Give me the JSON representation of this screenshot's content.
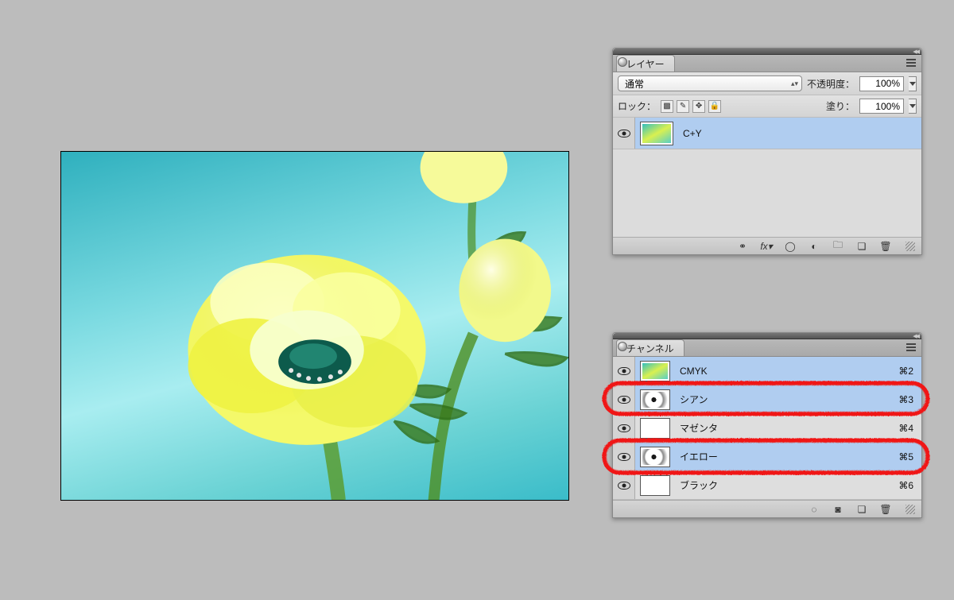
{
  "layers_panel": {
    "tab": "レイヤー",
    "blend_mode": "通常",
    "opacity_label": "不透明度：",
    "opacity_value": "100%",
    "lock_label": "ロック：",
    "fill_label": "塗り：",
    "fill_value": "100%",
    "items": [
      {
        "name": "C+Y",
        "visible": true,
        "selected": true
      }
    ],
    "bottom_icons": [
      "link-icon",
      "fx-icon",
      "mask-icon",
      "adjustment-icon",
      "group-icon",
      "new-icon",
      "trash-icon"
    ]
  },
  "channels_panel": {
    "tab": "チャンネル",
    "items": [
      {
        "name": "CMYK",
        "shortcut": "⌘2",
        "visible": true,
        "thumb": "color",
        "selected": true,
        "highlighted": false
      },
      {
        "name": "シアン",
        "shortcut": "⌘3",
        "visible": true,
        "thumb": "gray",
        "selected": true,
        "highlighted": true
      },
      {
        "name": "マゼンタ",
        "shortcut": "⌘4",
        "visible": true,
        "thumb": "white",
        "selected": false,
        "highlighted": false
      },
      {
        "name": "イエロー",
        "shortcut": "⌘5",
        "visible": true,
        "thumb": "gray",
        "selected": true,
        "highlighted": true
      },
      {
        "name": "ブラック",
        "shortcut": "⌘6",
        "visible": true,
        "thumb": "white",
        "selected": false,
        "highlighted": false
      }
    ],
    "bottom_icons": [
      "load-selection-icon",
      "save-selection-icon",
      "new-channel-icon",
      "trash-icon"
    ]
  }
}
